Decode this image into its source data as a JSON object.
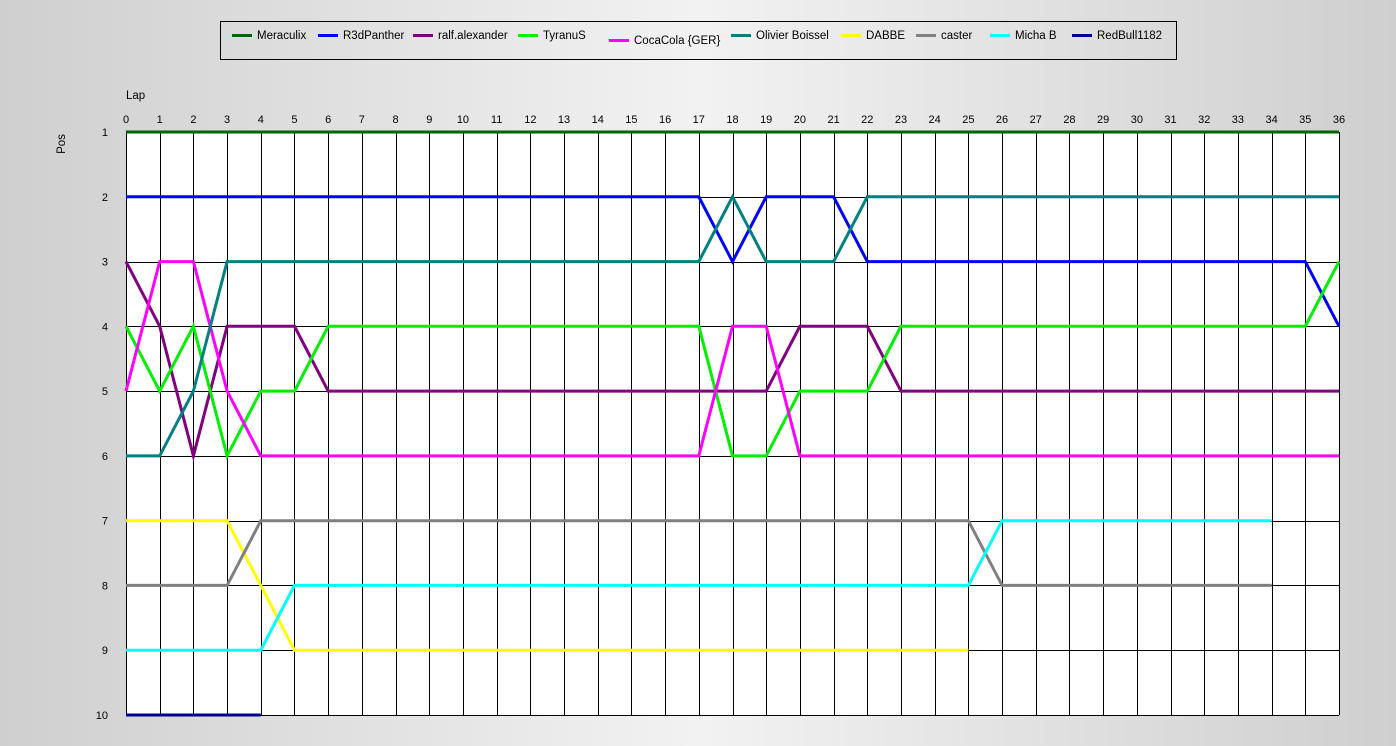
{
  "chart_data": {
    "type": "line",
    "xlabel": "Lap",
    "ylabel": "Pos",
    "xlim": [
      0,
      36
    ],
    "ylim": [
      1,
      10
    ],
    "y_inverted": true,
    "grid": true,
    "legend_placement": "top",
    "x_ticks": [
      0,
      1,
      2,
      3,
      4,
      5,
      6,
      7,
      8,
      9,
      10,
      11,
      12,
      13,
      14,
      15,
      16,
      17,
      18,
      19,
      20,
      21,
      22,
      23,
      24,
      25,
      26,
      27,
      28,
      29,
      30,
      31,
      32,
      33,
      34,
      35,
      36
    ],
    "y_ticks": [
      1,
      2,
      3,
      4,
      5,
      6,
      7,
      8,
      9,
      10
    ],
    "series": [
      {
        "name": "Meraculix",
        "color": "#006400",
        "values": [
          1,
          1,
          1,
          1,
          1,
          1,
          1,
          1,
          1,
          1,
          1,
          1,
          1,
          1,
          1,
          1,
          1,
          1,
          1,
          1,
          1,
          1,
          1,
          1,
          1,
          1,
          1,
          1,
          1,
          1,
          1,
          1,
          1,
          1,
          1,
          1,
          1
        ]
      },
      {
        "name": "R3dPanther",
        "color": "#0000ff",
        "values": [
          2,
          2,
          2,
          2,
          2,
          2,
          2,
          2,
          2,
          2,
          2,
          2,
          2,
          2,
          2,
          2,
          2,
          2,
          3,
          2,
          2,
          2,
          3,
          3,
          3,
          3,
          3,
          3,
          3,
          3,
          3,
          3,
          3,
          3,
          3,
          3,
          4
        ]
      },
      {
        "name": "ralf.alexander",
        "color": "#800080",
        "values": [
          3,
          4,
          6,
          4,
          4,
          4,
          5,
          5,
          5,
          5,
          5,
          5,
          5,
          5,
          5,
          5,
          5,
          5,
          5,
          5,
          4,
          4,
          4,
          5,
          5,
          5,
          5,
          5,
          5,
          5,
          5,
          5,
          5,
          5,
          5,
          5,
          5
        ]
      },
      {
        "name": "TyranuS",
        "color": "#00ee00",
        "values": [
          4,
          5,
          4,
          6,
          5,
          5,
          4,
          4,
          4,
          4,
          4,
          4,
          4,
          4,
          4,
          4,
          4,
          4,
          6,
          6,
          5,
          5,
          5,
          4,
          4,
          4,
          4,
          4,
          4,
          4,
          4,
          4,
          4,
          4,
          4,
          4,
          3
        ]
      },
      {
        "name": "CocaCola {GER}",
        "color": "#ff00ff",
        "values": [
          5,
          3,
          3,
          5,
          6,
          6,
          6,
          6,
          6,
          6,
          6,
          6,
          6,
          6,
          6,
          6,
          6,
          6,
          4,
          4,
          6,
          6,
          6,
          6,
          6,
          6,
          6,
          6,
          6,
          6,
          6,
          6,
          6,
          6,
          6,
          6,
          6
        ]
      },
      {
        "name": "Olivier Boissel",
        "color": "#008080",
        "values": [
          6,
          6,
          5,
          3,
          3,
          3,
          3,
          3,
          3,
          3,
          3,
          3,
          3,
          3,
          3,
          3,
          3,
          3,
          2,
          3,
          3,
          3,
          2,
          2,
          2,
          2,
          2,
          2,
          2,
          2,
          2,
          2,
          2,
          2,
          2,
          2,
          2
        ]
      },
      {
        "name": "DABBE",
        "color": "#ffff00",
        "values": [
          7,
          7,
          7,
          7,
          8,
          9,
          9,
          9,
          9,
          9,
          9,
          9,
          9,
          9,
          9,
          9,
          9,
          9,
          9,
          9,
          9,
          9,
          9,
          9,
          9,
          9
        ]
      },
      {
        "name": "caster",
        "color": "#808080",
        "values": [
          8,
          8,
          8,
          8,
          7,
          7,
          7,
          7,
          7,
          7,
          7,
          7,
          7,
          7,
          7,
          7,
          7,
          7,
          7,
          7,
          7,
          7,
          7,
          7,
          7,
          7,
          8,
          8,
          8,
          8,
          8,
          8,
          8,
          8,
          8
        ]
      },
      {
        "name": "Micha B",
        "color": "#00ffff",
        "values": [
          9,
          9,
          9,
          9,
          9,
          8,
          8,
          8,
          8,
          8,
          8,
          8,
          8,
          8,
          8,
          8,
          8,
          8,
          8,
          8,
          8,
          8,
          8,
          8,
          8,
          8,
          7,
          7,
          7,
          7,
          7,
          7,
          7,
          7,
          7
        ]
      },
      {
        "name": "RedBull1182",
        "color": "#00008b",
        "values": [
          10,
          10,
          10,
          10,
          10
        ]
      }
    ]
  }
}
